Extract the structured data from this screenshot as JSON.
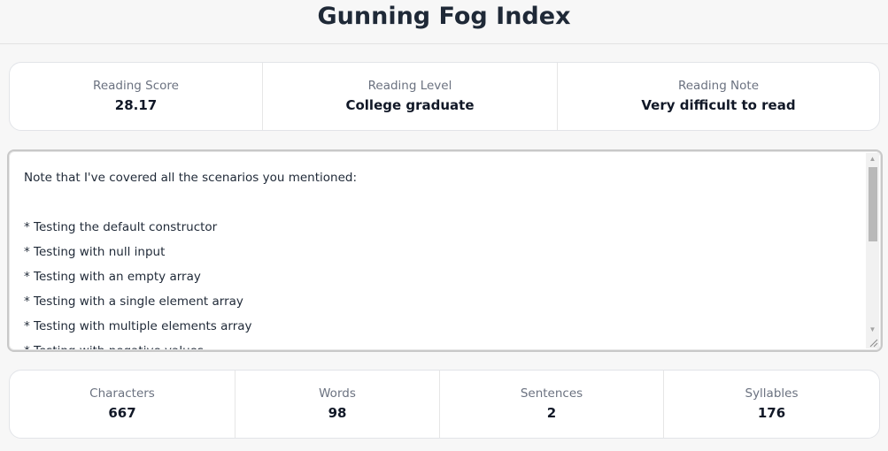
{
  "header": {
    "title": "Gunning Fog Index"
  },
  "reading": [
    {
      "label": "Reading Score",
      "value": "28.17"
    },
    {
      "label": "Reading Level",
      "value": "College graduate"
    },
    {
      "label": "Reading Note",
      "value": "Very difficult to read"
    }
  ],
  "editor": {
    "lines": [
      "Note that I've covered all the scenarios you mentioned:",
      "",
      "* Testing the default constructor",
      "* Testing with null input",
      "* Testing with an empty array",
      "* Testing with a single element array",
      "* Testing with multiple elements array",
      "* Testing with negative values"
    ]
  },
  "stats": [
    {
      "label": "Characters",
      "value": "667"
    },
    {
      "label": "Words",
      "value": "98"
    },
    {
      "label": "Sentences",
      "value": "2"
    },
    {
      "label": "Syllables",
      "value": "176"
    }
  ]
}
